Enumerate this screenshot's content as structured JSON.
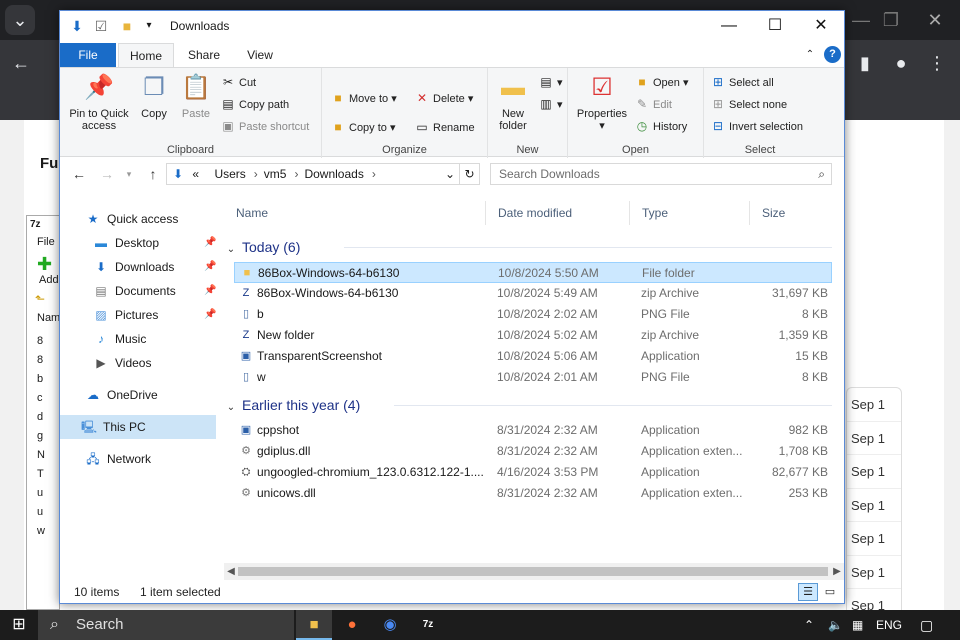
{
  "browser": {
    "tab_icon": "chevron-down-icon",
    "behind_page_heading": "Fu",
    "sevenzip": {
      "title_glyph": "7z",
      "menu_file": "File",
      "add_label": "Add",
      "list_header": "Nam",
      "rows": [
        "8",
        "8",
        "b",
        "c",
        "d",
        "g",
        "N",
        "T",
        "u",
        "u",
        "w"
      ]
    },
    "sep_items": [
      "Sep 1",
      "Sep 1",
      "Sep 1",
      "Sep 1",
      "Sep 1",
      "Sep 1",
      "Sep 1"
    ]
  },
  "window": {
    "title": "Downloads",
    "controls": {
      "minimize": "—",
      "maximize": "☐",
      "close": "✕"
    }
  },
  "tabs": {
    "file": "File",
    "home": "Home",
    "share": "Share",
    "view": "View"
  },
  "ribbon": {
    "clipboard": {
      "label": "Clipboard",
      "pin": "Pin to Quick access",
      "copy": "Copy",
      "paste": "Paste",
      "cut": "Cut",
      "copy_path": "Copy path",
      "paste_shortcut": "Paste shortcut"
    },
    "organize": {
      "label": "Organize",
      "move_to": "Move to",
      "copy_to": "Copy to",
      "delete": "Delete",
      "rename": "Rename"
    },
    "new": {
      "label": "New",
      "new_folder": "New folder"
    },
    "open": {
      "label": "Open",
      "properties": "Properties",
      "open": "Open",
      "edit": "Edit",
      "history": "History"
    },
    "select": {
      "label": "Select",
      "select_all": "Select all",
      "select_none": "Select none",
      "invert": "Invert selection"
    }
  },
  "address": {
    "prefix": "«",
    "crumbs": [
      "Users",
      "vm5",
      "Downloads"
    ],
    "search_placeholder": "Search Downloads"
  },
  "nav": {
    "quick_access": "Quick access",
    "items": [
      "Desktop",
      "Downloads",
      "Documents",
      "Pictures",
      "Music",
      "Videos"
    ],
    "onedrive": "OneDrive",
    "this_pc": "This PC",
    "network": "Network"
  },
  "columns": {
    "name": "Name",
    "date": "Date modified",
    "type": "Type",
    "size": "Size"
  },
  "groups": {
    "today": "Today (6)",
    "earlier": "Earlier this year (4)"
  },
  "files_today": [
    {
      "name": "86Box-Windows-64-b6130",
      "date": "10/8/2024 5:50 AM",
      "type": "File folder",
      "size": "",
      "icon": "folder-icon"
    },
    {
      "name": "86Box-Windows-64-b6130",
      "date": "10/8/2024 5:49 AM",
      "type": "zip Archive",
      "size": "31,697 KB",
      "icon": "zip-icon"
    },
    {
      "name": "b",
      "date": "10/8/2024 2:02 AM",
      "type": "PNG File",
      "size": "8 KB",
      "icon": "image-file-icon"
    },
    {
      "name": "New folder",
      "date": "10/8/2024 5:02 AM",
      "type": "zip Archive",
      "size": "1,359 KB",
      "icon": "zip-icon"
    },
    {
      "name": "TransparentScreenshot",
      "date": "10/8/2024 5:06 AM",
      "type": "Application",
      "size": "15 KB",
      "icon": "app-icon"
    },
    {
      "name": "w",
      "date": "10/8/2024 2:01 AM",
      "type": "PNG File",
      "size": "8 KB",
      "icon": "image-file-icon"
    }
  ],
  "files_earlier": [
    {
      "name": "cppshot",
      "date": "8/31/2024 2:32 AM",
      "type": "Application",
      "size": "982 KB",
      "icon": "app-icon"
    },
    {
      "name": "gdiplus.dll",
      "date": "8/31/2024 2:32 AM",
      "type": "Application exten...",
      "size": "1,708 KB",
      "icon": "dll-icon"
    },
    {
      "name": "ungoogled-chromium_123.0.6312.122-1....",
      "date": "4/16/2024 3:53 PM",
      "type": "Application",
      "size": "82,677 KB",
      "icon": "installer-icon"
    },
    {
      "name": "unicows.dll",
      "date": "8/31/2024 2:32 AM",
      "type": "Application exten...",
      "size": "253 KB",
      "icon": "dll-icon"
    }
  ],
  "status": {
    "items": "10 items",
    "selected": "1 item selected"
  },
  "taskbar": {
    "search": "Search",
    "lang": "ENG"
  }
}
